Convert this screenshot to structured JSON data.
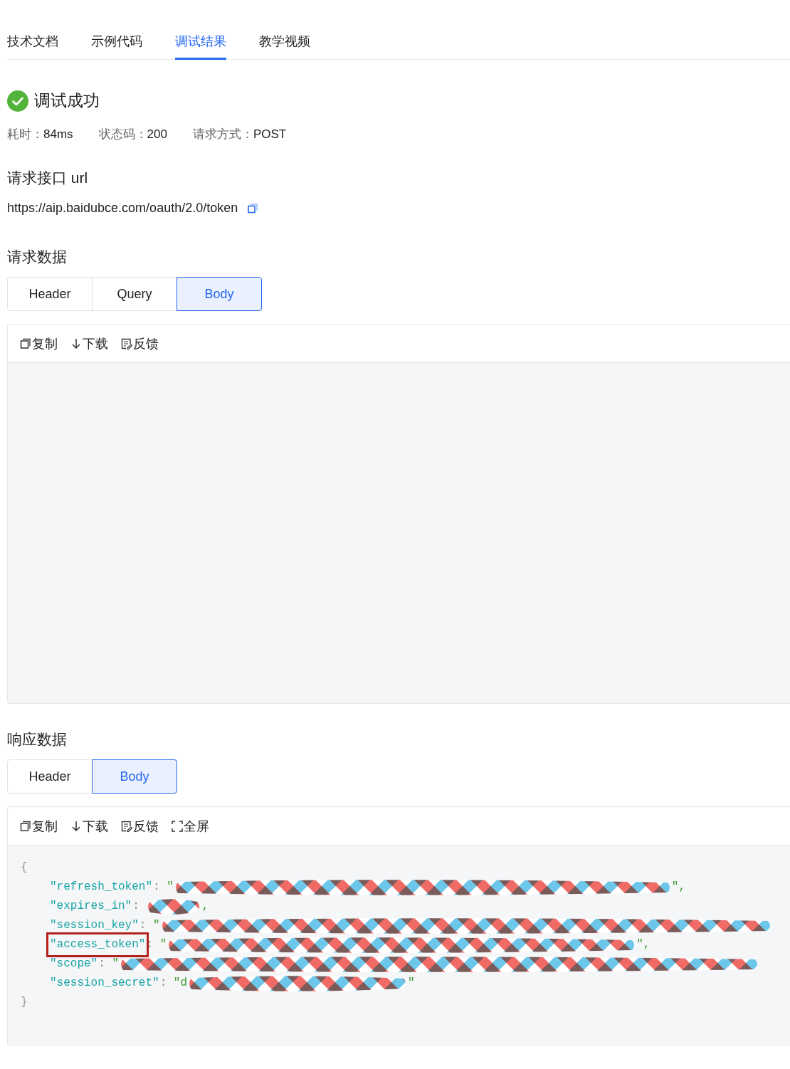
{
  "tabs": [
    {
      "label": "技术文档",
      "selected": false
    },
    {
      "label": "示例代码",
      "selected": false
    },
    {
      "label": "调试结果",
      "selected": true
    },
    {
      "label": "教学视频",
      "selected": false
    }
  ],
  "result": {
    "title": "调试成功",
    "success": true,
    "stats": [
      {
        "label": "耗时：",
        "value": "84ms"
      },
      {
        "label": "状态码：",
        "value": "200"
      },
      {
        "label": "请求方式：",
        "value": "POST"
      }
    ]
  },
  "url_section": {
    "heading": "请求接口 url",
    "url": "https://aip.baidubce.com/oauth/2.0/token"
  },
  "request": {
    "heading": "请求数据",
    "tabs": [
      {
        "label": "Header",
        "selected": false
      },
      {
        "label": "Query",
        "selected": false
      },
      {
        "label": "Body",
        "selected": true
      }
    ],
    "toolbar": [
      {
        "kind": "copy",
        "label": "复制"
      },
      {
        "kind": "download",
        "label": "下载"
      },
      {
        "kind": "feedback",
        "label": "反馈"
      }
    ]
  },
  "response": {
    "heading": "响应数据",
    "tabs": [
      {
        "label": "Header",
        "selected": false
      },
      {
        "label": "Body",
        "selected": true
      }
    ],
    "toolbar": [
      {
        "kind": "copy",
        "label": "复制"
      },
      {
        "kind": "download",
        "label": "下载"
      },
      {
        "kind": "feedback",
        "label": "反馈"
      },
      {
        "kind": "fullscreen",
        "label": "全屏"
      }
    ],
    "code": {
      "open": "{",
      "close": "}",
      "lines": [
        {
          "key": "\"refresh_token\"",
          "sep": ": ",
          "prefix": "\"",
          "suffix": "\",",
          "highlighted": false
        },
        {
          "key": "\"expires_in\"",
          "sep": ": ",
          "suffix": ",",
          "highlighted": false
        },
        {
          "key": "\"session_key\"",
          "sep": ": ",
          "prefix": "\"",
          "highlighted": false
        },
        {
          "key": "\"access_token\"",
          "sep": ": ",
          "prefix": "\"",
          "suffix": "\",",
          "highlighted": true
        },
        {
          "key": "\"scope\"",
          "sep": ": ",
          "prefix": "\"",
          "highlighted": false
        },
        {
          "key": "\"session_secret\"",
          "sep": ": ",
          "prefix": "\"d",
          "suffix": "\"",
          "highlighted": false
        }
      ]
    }
  }
}
